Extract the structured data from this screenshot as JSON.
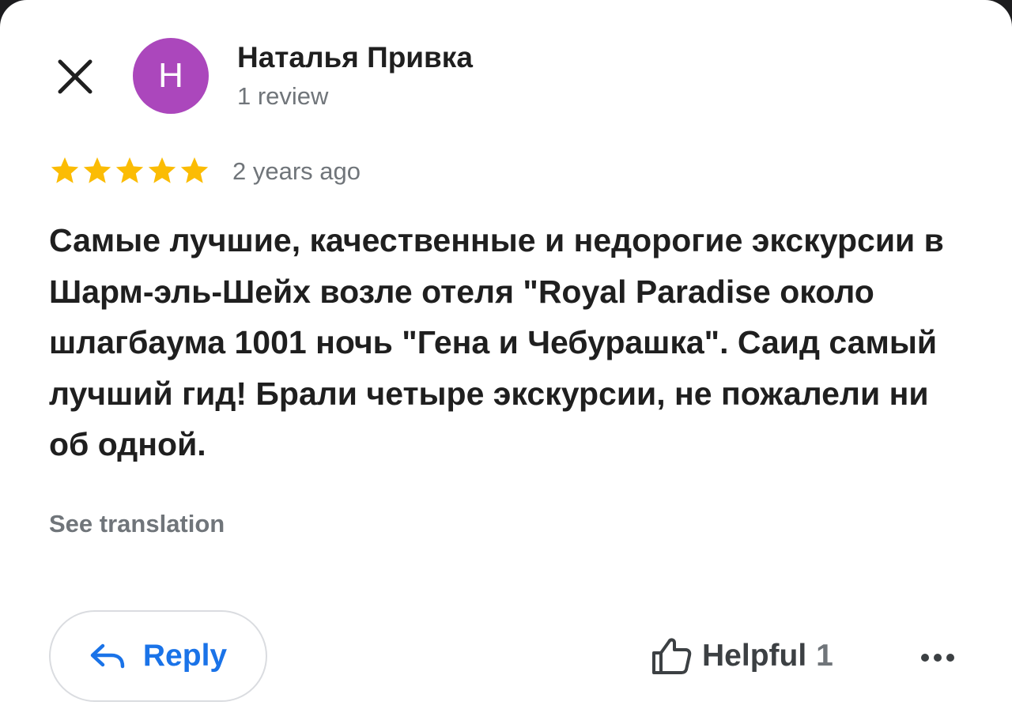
{
  "colors": {
    "avatar_bg": "#ab47bc",
    "star": "#fbbc04",
    "link_blue": "#1a73e8",
    "muted_text": "#70757a"
  },
  "review": {
    "author": {
      "initial": "Н",
      "name": "Наталья Привка",
      "review_count": "1 review"
    },
    "rating": 5,
    "max_rating": 5,
    "time_ago": "2 years ago",
    "text": "Самые лучшие, качественные и недорогие экскурсии в Шарм-эль-Шейх возле отеля \"Royal Paradise около шлагбаума 1001 ночь \"Гена и Чебурашка\". Саид самый лучший гид! Брали четыре экскурсии, не пожалели ни об одной.",
    "see_translation": "See translation"
  },
  "actions": {
    "close_icon": "close-icon",
    "reply_label": "Reply",
    "reply_icon": "reply-arrow-icon",
    "helpful_label": "Helpful",
    "helpful_count": "1",
    "helpful_icon": "thumb-up-icon",
    "more_icon": "more-horizontal-icon"
  }
}
